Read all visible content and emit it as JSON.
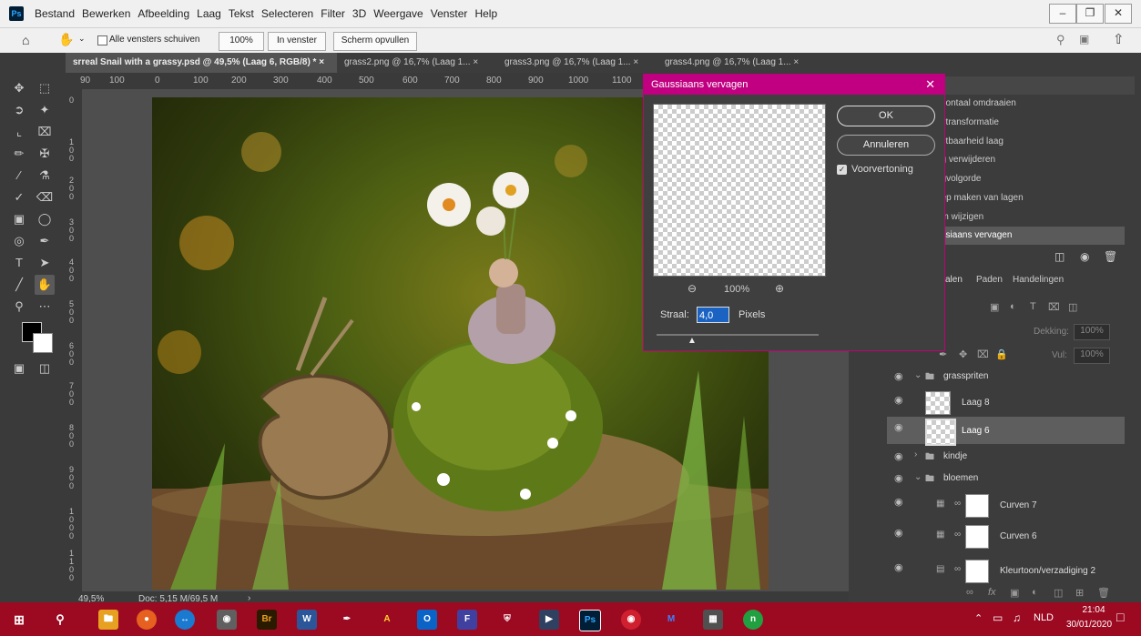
{
  "app": {
    "logo": "Ps"
  },
  "menu": [
    "Bestand",
    "Bewerken",
    "Afbeelding",
    "Laag",
    "Tekst",
    "Selecteren",
    "Filter",
    "3D",
    "Weergave",
    "Venster",
    "Help"
  ],
  "options_bar": {
    "scroll_all_label": "Alle vensters schuiven",
    "zoom_100": "100%",
    "fit_window": "In venster",
    "fill_screen": "Scherm opvullen"
  },
  "tabs": [
    {
      "label": "srreal Snail with a grassy.psd @ 49,5% (Laag 6, RGB/8) * ×"
    },
    {
      "label": "grass2.png @ 16,7% (Laag 1... ×"
    },
    {
      "label": "grass3.png @ 16,7% (Laag 1... ×"
    },
    {
      "label": "grass4.png @ 16,7% (Laag 1... ×"
    }
  ],
  "ruler_h": [
    "90",
    "100",
    "0",
    "100",
    "200",
    "300",
    "400",
    "500",
    "600",
    "700",
    "800",
    "900",
    "1000",
    "1100"
  ],
  "ruler_v": [
    "0",
    "1 0 0",
    "2 0 0",
    "3 0 0",
    "4 0 0",
    "5 0 0",
    "6 0 0",
    "7 0 0",
    "8 0 0",
    "9 0 0",
    "1 0 0 0",
    "1 1 0 0",
    "1 2 0 0"
  ],
  "status": {
    "zoom": "49,5%",
    "doc": "Doc: 5,15 M/69,5 M"
  },
  "history": {
    "items": [
      "rizontaal omdraaien",
      "je transformatie",
      "chtbaarheid laag",
      "ag verwijderen",
      "agvolgorde",
      "oep maken van lagen",
      "am wijzigen",
      "ussiaans vervagen"
    ]
  },
  "layers_panel": {
    "tabs": [
      "alen",
      "Paden",
      "Handelingen"
    ],
    "opacity_label": "Dekking:",
    "opacity_value": "100%",
    "fill_label": "Vul:",
    "fill_value": "100%",
    "layers": [
      {
        "name": "grasspriten",
        "type": "group"
      },
      {
        "name": "Laag 8",
        "type": "layer"
      },
      {
        "name": "Laag 6",
        "type": "layer",
        "selected": true
      },
      {
        "name": "kindje",
        "type": "group"
      },
      {
        "name": "bloemen",
        "type": "group"
      },
      {
        "name": "Curven 7",
        "type": "adjustment"
      },
      {
        "name": "Curven 6",
        "type": "adjustment"
      },
      {
        "name": "Kleurtoon/verzadiging 2",
        "type": "adjustment"
      }
    ]
  },
  "dialog": {
    "title": "Gaussiaans vervagen",
    "ok": "OK",
    "cancel": "Annuleren",
    "preview_label": "Voorvertoning",
    "preview_checked": true,
    "zoom": "100%",
    "radius_label": "Straal:",
    "radius_value": "4,0",
    "radius_unit": "Pixels"
  },
  "taskbar": {
    "lang": "NLD",
    "time": "21:04",
    "date": "30/01/2020",
    "icons": [
      "start-icon",
      "search-icon",
      "file-explorer-icon",
      "firefox-icon",
      "teamviewer-icon",
      "webcam-icon",
      "bridge-icon",
      "word-icon",
      "pen-icon",
      "ai-icon",
      "outlook-icon",
      "font-viewer-icon",
      "shield-icon",
      "media-icon",
      "photoshop-icon",
      "screen-record-icon",
      "malwarebytes-icon",
      "calculator-icon",
      "n-icon"
    ]
  },
  "colors": {
    "accent": "#c00080",
    "taskbar": "#9c0a22",
    "panel": "#3c3c3c",
    "ps_blue": "#31a8ff"
  }
}
